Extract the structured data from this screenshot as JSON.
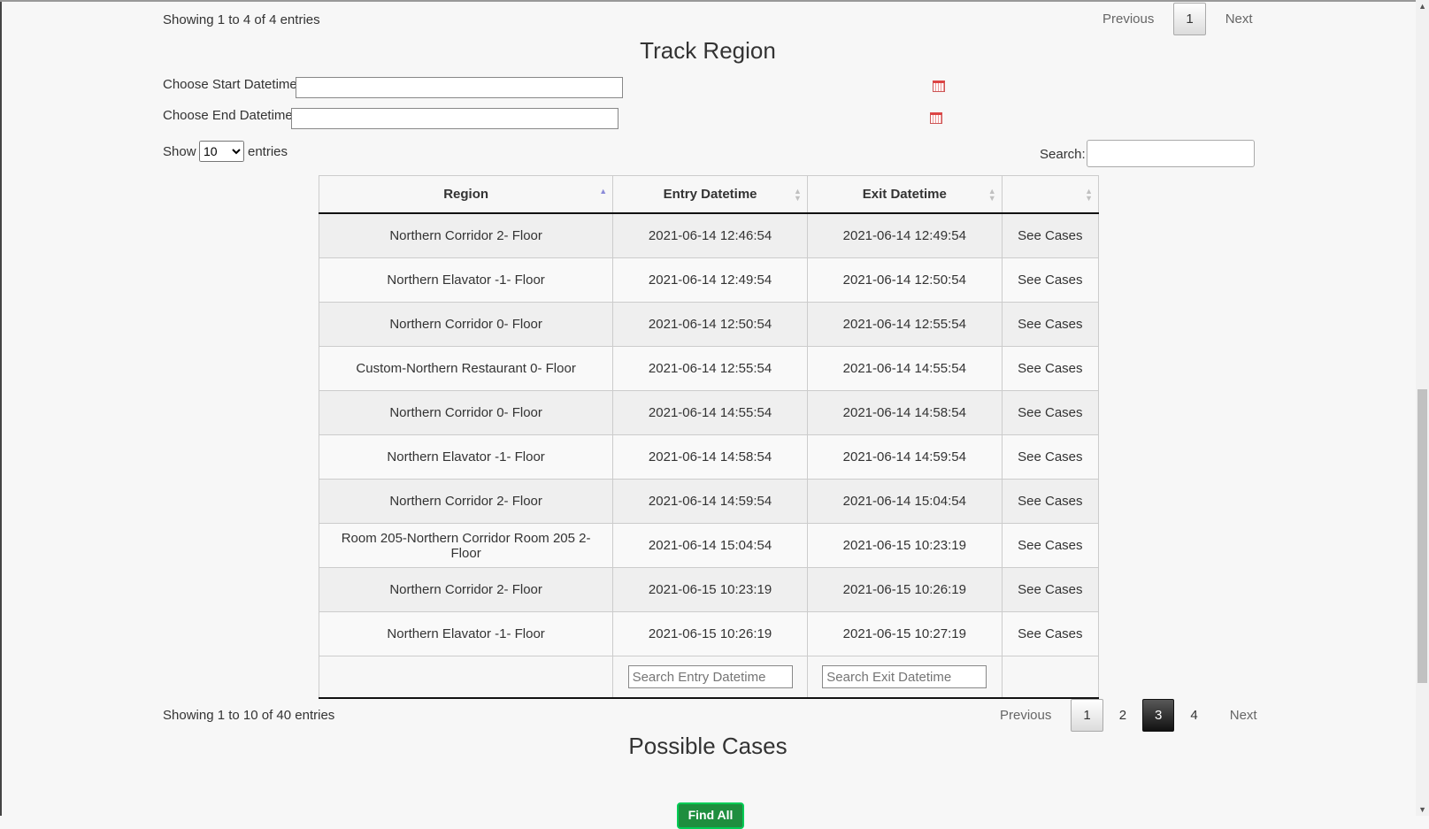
{
  "top_table": {
    "info": "Showing 1 to 4 of 4 entries",
    "pager": {
      "previous": "Previous",
      "pages": [
        "1"
      ],
      "next": "Next"
    }
  },
  "track_region": {
    "title": "Track Region",
    "start_label": "Choose Start Datetime:",
    "end_label": "Choose End Datetime:",
    "show_label": "Show",
    "entries_label": "entries",
    "length_value": "10",
    "length_options": [
      "10"
    ],
    "search_label": "Search:",
    "columns": [
      "Region",
      "Entry Datetime",
      "Exit Datetime",
      ""
    ],
    "rows": [
      {
        "region": "Northern Corridor 2- Floor",
        "entry": "2021-06-14 12:46:54",
        "exit": "2021-06-14 12:49:54",
        "action": "See Cases"
      },
      {
        "region": "Northern Elavator -1- Floor",
        "entry": "2021-06-14 12:49:54",
        "exit": "2021-06-14 12:50:54",
        "action": "See Cases"
      },
      {
        "region": "Northern Corridor 0- Floor",
        "entry": "2021-06-14 12:50:54",
        "exit": "2021-06-14 12:55:54",
        "action": "See Cases"
      },
      {
        "region": "Custom-Northern Restaurant 0- Floor",
        "entry": "2021-06-14 12:55:54",
        "exit": "2021-06-14 14:55:54",
        "action": "See Cases"
      },
      {
        "region": "Northern Corridor 0- Floor",
        "entry": "2021-06-14 14:55:54",
        "exit": "2021-06-14 14:58:54",
        "action": "See Cases"
      },
      {
        "region": "Northern Elavator -1- Floor",
        "entry": "2021-06-14 14:58:54",
        "exit": "2021-06-14 14:59:54",
        "action": "See Cases"
      },
      {
        "region": "Northern Corridor 2- Floor",
        "entry": "2021-06-14 14:59:54",
        "exit": "2021-06-14 15:04:54",
        "action": "See Cases"
      },
      {
        "region": "Room 205-Northern Corridor Room 205 2- Floor",
        "entry": "2021-06-14 15:04:54",
        "exit": "2021-06-15 10:23:19",
        "action": "See Cases"
      },
      {
        "region": "Northern Corridor 2- Floor",
        "entry": "2021-06-15 10:23:19",
        "exit": "2021-06-15 10:26:19",
        "action": "See Cases"
      },
      {
        "region": "Northern Elavator -1- Floor",
        "entry": "2021-06-15 10:26:19",
        "exit": "2021-06-15 10:27:19",
        "action": "See Cases"
      }
    ],
    "footer_entry_placeholder": "Search Entry Datetime",
    "footer_exit_placeholder": "Search Exit Datetime",
    "info": "Showing 1 to 10 of 40 entries",
    "pager": {
      "previous": "Previous",
      "pages": [
        "1",
        "2",
        "3",
        "4"
      ],
      "current": "3",
      "next": "Next"
    }
  },
  "possible_cases": {
    "title": "Possible Cases",
    "button": "Find All"
  }
}
